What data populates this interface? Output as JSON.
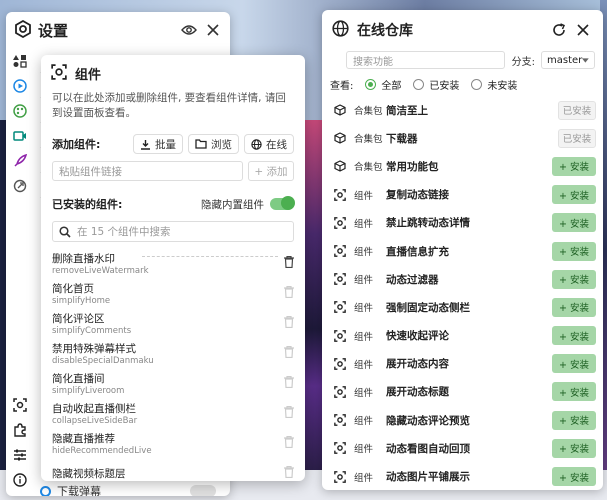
{
  "settings": {
    "title": "设置",
    "bottom_item_label": "下载弹幕"
  },
  "components": {
    "title": "组件",
    "description": "可以在此处添加或删除组件, 要查看组件详情, 请回到设置面板查看。",
    "add_label": "添加组件:",
    "batch_label": "批量",
    "browse_label": "浏览",
    "online_label": "在线",
    "link_placeholder": "粘贴组件链接",
    "add_button_label": "+ 添加",
    "installed_label": "已安装的组件:",
    "hide_builtin_label": "隐藏内置组件",
    "search_placeholder": "在 15 个组件中搜索",
    "items": [
      {
        "title": "删除直播水印",
        "id": "removeLiveWatermark"
      },
      {
        "title": "简化首页",
        "id": "simplifyHome"
      },
      {
        "title": "简化评论区",
        "id": "simplifyComments"
      },
      {
        "title": "禁用特殊弹幕样式",
        "id": "disableSpecialDanmaku"
      },
      {
        "title": "简化直播间",
        "id": "simplifyLiveroom"
      },
      {
        "title": "自动收起直播侧栏",
        "id": "collapseLiveSideBar"
      },
      {
        "title": "隐藏直播推荐",
        "id": "hideRecommendedLive"
      },
      {
        "title": "隐藏视频标题层",
        "id": ""
      }
    ]
  },
  "store": {
    "title": "在线仓库",
    "search_placeholder": "搜索功能",
    "branch_label": "分支:",
    "branch_value": "master",
    "view_label": "查看:",
    "filters": [
      "全部",
      "已安装",
      "未安装"
    ],
    "install_label": "+ 安装",
    "installed_label": "已安装",
    "rows": [
      {
        "type": "合集包",
        "name": "简洁至上",
        "status": "installed"
      },
      {
        "type": "合集包",
        "name": "下载器",
        "status": "installed"
      },
      {
        "type": "合集包",
        "name": "常用功能包",
        "status": "install"
      },
      {
        "type": "组件",
        "name": "复制动态链接",
        "status": "install"
      },
      {
        "type": "组件",
        "name": "禁止跳转动态详情",
        "status": "install"
      },
      {
        "type": "组件",
        "name": "直播信息扩充",
        "status": "install"
      },
      {
        "type": "组件",
        "name": "动态过滤器",
        "status": "install"
      },
      {
        "type": "组件",
        "name": "强制固定动态侧栏",
        "status": "install"
      },
      {
        "type": "组件",
        "name": "快速收起评论",
        "status": "install"
      },
      {
        "type": "组件",
        "name": "展开动态内容",
        "status": "install"
      },
      {
        "type": "组件",
        "name": "展开动态标题",
        "status": "install"
      },
      {
        "type": "组件",
        "name": "隐藏动态评论预览",
        "status": "install"
      },
      {
        "type": "组件",
        "name": "动态看图自动回顶",
        "status": "install"
      },
      {
        "type": "组件",
        "name": "动态图片平铺展示",
        "status": "install"
      }
    ]
  },
  "colors": {
    "accent_green": "#4caf50",
    "install_bg": "#a5d6a7",
    "accent_blue": "#1e88e5"
  }
}
